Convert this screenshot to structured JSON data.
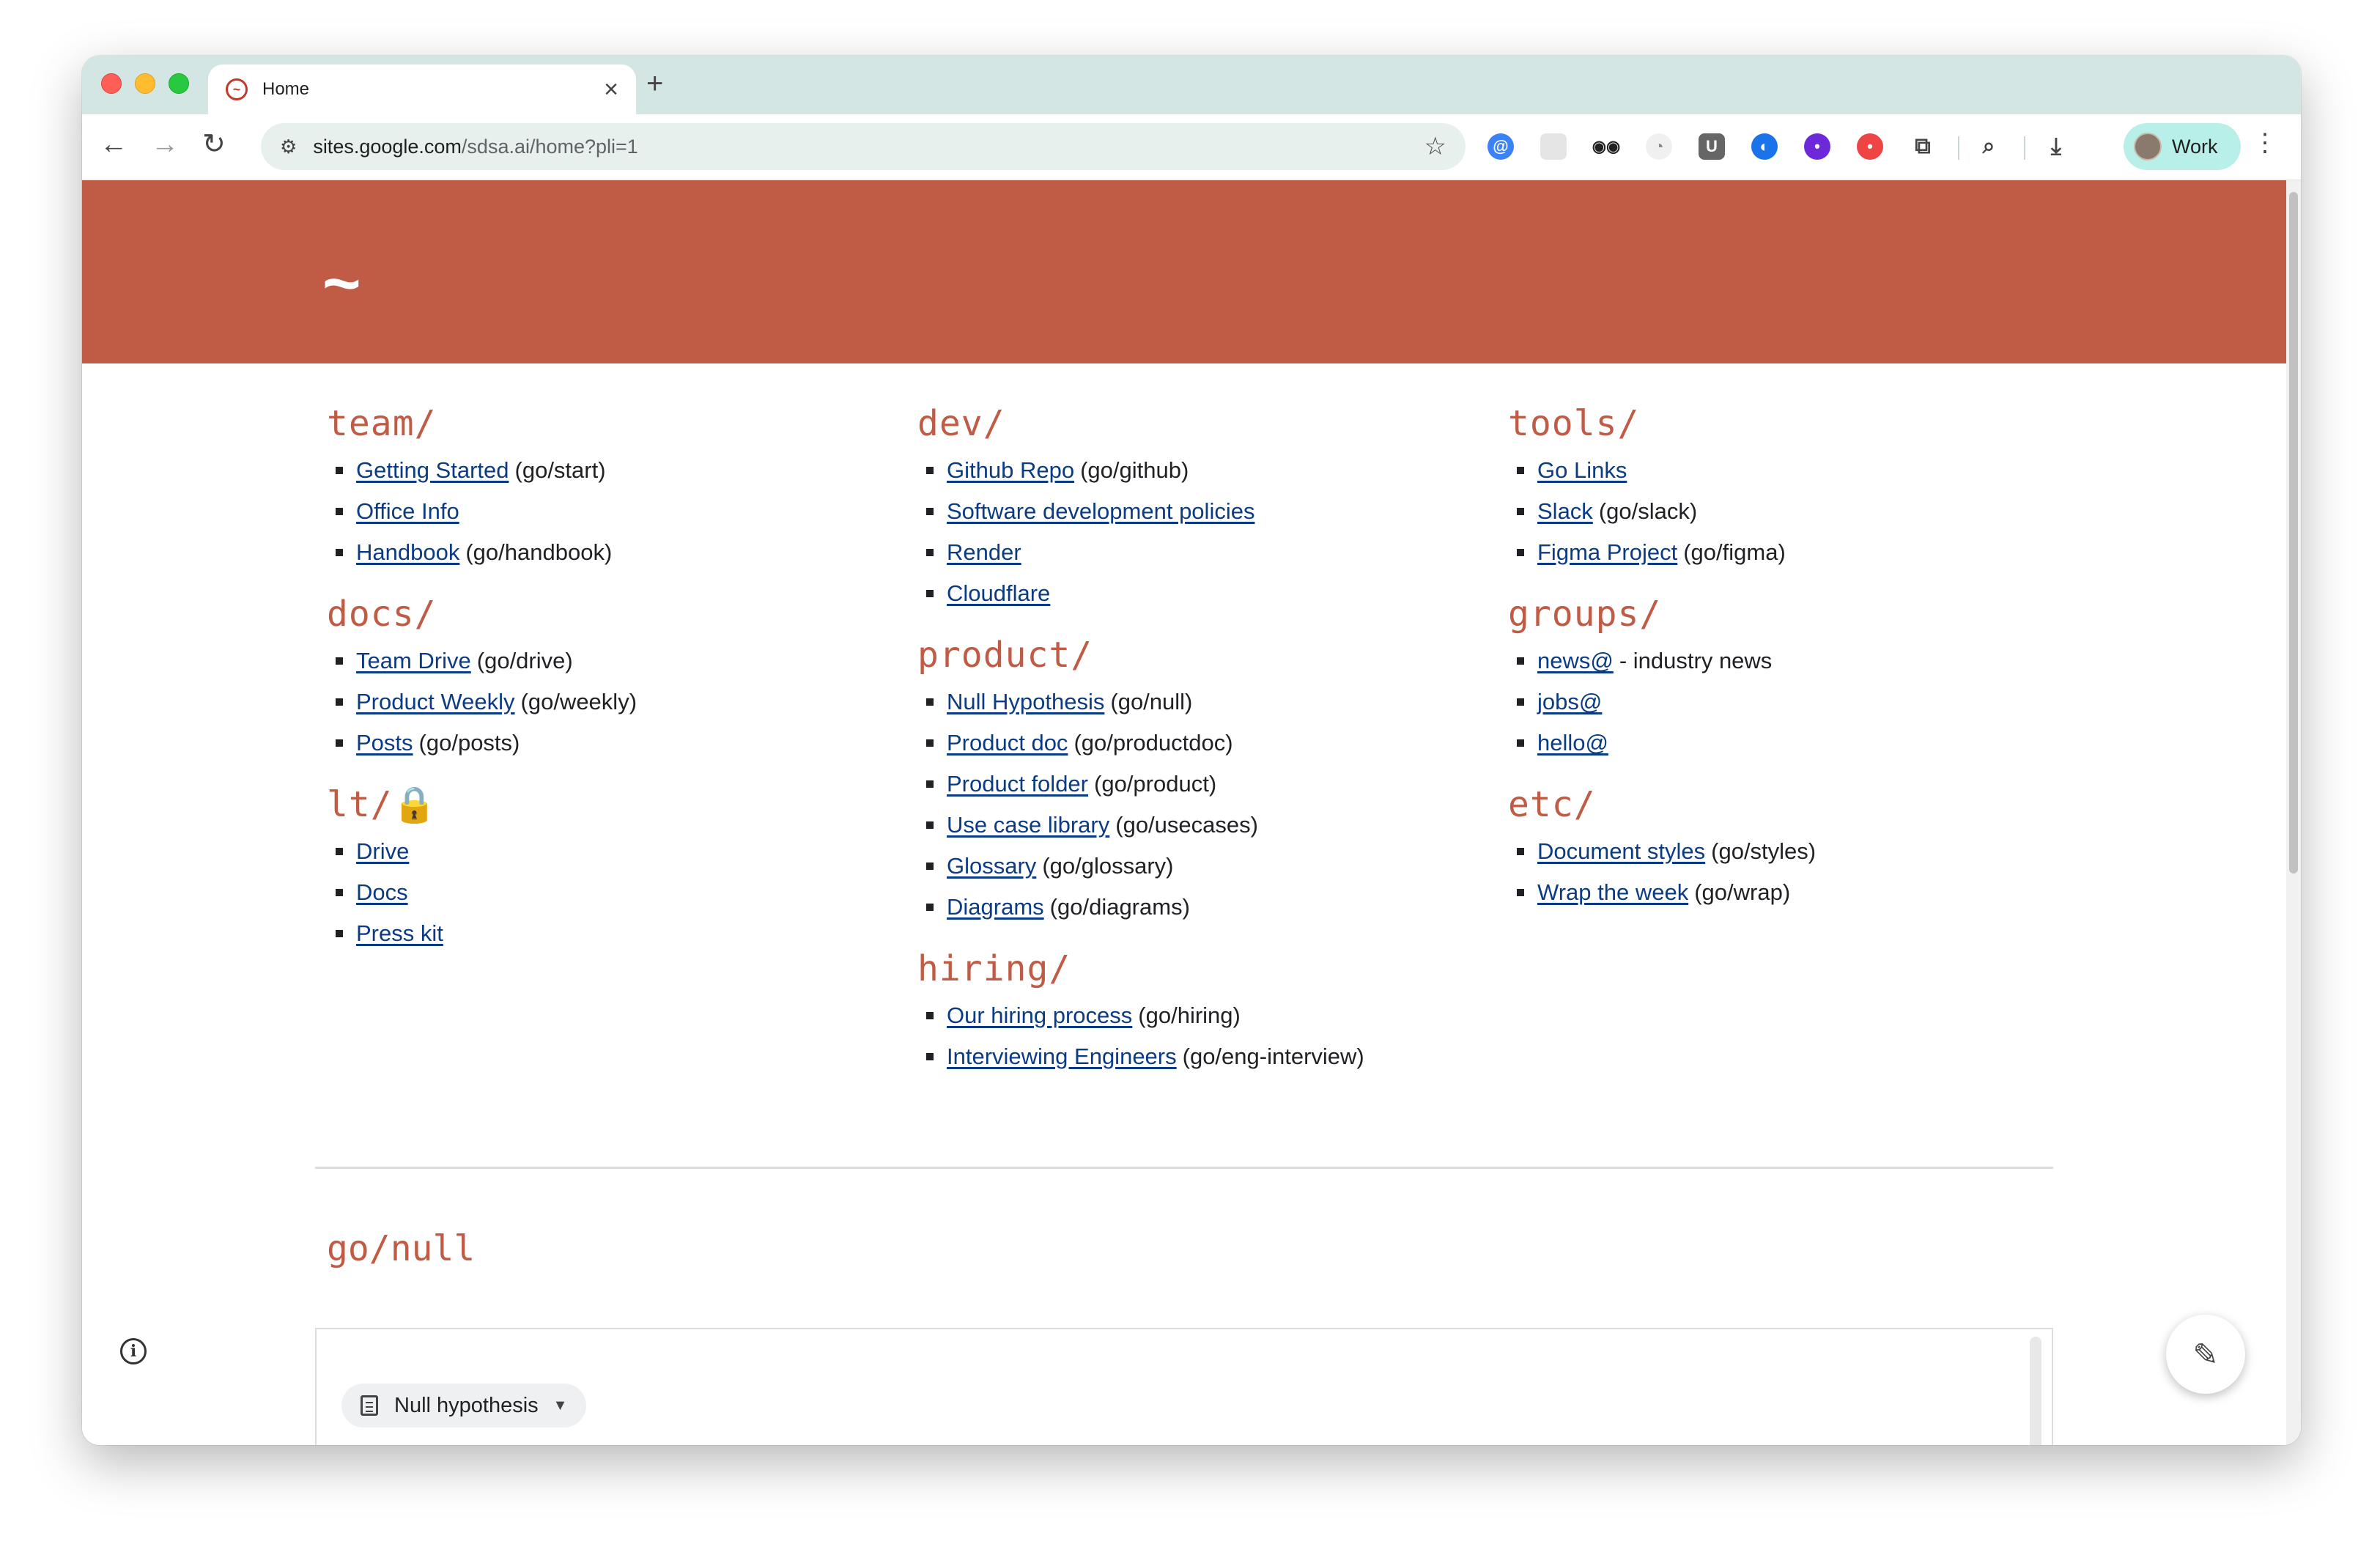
{
  "browser": {
    "tab_title": "Home",
    "close_glyph": "×",
    "newtab_glyph": "+",
    "url_host": "sites.google.com",
    "url_path": "/sdsa.ai/home?pli=1",
    "profile_label": "Work",
    "icons": {
      "back": "arrow-left-icon",
      "forward": "arrow-right-icon",
      "reload": "reload-icon",
      "star": "star-icon",
      "menu": "three-dots-icon",
      "download": "download-icon",
      "extensions": "puzzle-icon"
    }
  },
  "banner": {
    "logo": "~",
    "color": "#c05b45"
  },
  "columns": [
    {
      "sections": [
        {
          "title": "team/",
          "items": [
            {
              "link": "Getting Started",
              "note": "(go/start)"
            },
            {
              "link": "Office Info",
              "note": ""
            },
            {
              "link": "Handbook",
              "note": "(go/handbook)"
            }
          ]
        },
        {
          "title": "docs/",
          "items": [
            {
              "link": "Team Drive",
              "note": "(go/drive)"
            },
            {
              "link": "Product Weekly",
              "note": "(go/weekly)"
            },
            {
              "link": "Posts",
              "note": "(go/posts)"
            }
          ]
        },
        {
          "title": "lt/🔒",
          "items": [
            {
              "link": "Drive",
              "note": ""
            },
            {
              "link": "Docs",
              "note": ""
            },
            {
              "link": "Press kit",
              "note": ""
            }
          ]
        }
      ]
    },
    {
      "sections": [
        {
          "title": "dev/",
          "items": [
            {
              "link": "Github Repo",
              "note": "(go/github)"
            },
            {
              "link": "Software development policies",
              "note": ""
            },
            {
              "link": "Render",
              "note": ""
            },
            {
              "link": "Cloudflare",
              "note": ""
            }
          ]
        },
        {
          "title": "product/",
          "items": [
            {
              "link": "Null Hypothesis",
              "note": "(go/null)"
            },
            {
              "link": "Product doc",
              "note": "(go/productdoc)"
            },
            {
              "link": "Product folder",
              "note": "(go/product)"
            },
            {
              "link": "Use case library",
              "note": "(go/usecases)"
            },
            {
              "link": "Glossary",
              "note": "(go/glossary)"
            },
            {
              "link": "Diagrams",
              "note": "(go/diagrams)"
            }
          ]
        },
        {
          "title": "hiring/",
          "items": [
            {
              "link": "Our hiring process",
              "note": "(go/hiring)"
            },
            {
              "link": "Interviewing Engineers",
              "note": "(go/eng-interview)"
            }
          ]
        }
      ]
    },
    {
      "sections": [
        {
          "title": "tools/",
          "items": [
            {
              "link": "Go Links",
              "note": ""
            },
            {
              "link": "Slack",
              "note": "(go/slack)"
            },
            {
              "link": "Figma Project",
              "note": "(go/figma)"
            }
          ]
        },
        {
          "title": "groups/",
          "items": [
            {
              "link": "news@",
              "note": "- industry news"
            },
            {
              "link": "jobs@",
              "note": ""
            },
            {
              "link": "hello@",
              "note": ""
            }
          ]
        },
        {
          "title": "etc/",
          "items": [
            {
              "link": "Document styles",
              "note": "(go/styles)"
            },
            {
              "link": "Wrap the week",
              "note": "(go/wrap)"
            }
          ]
        }
      ]
    }
  ],
  "go_null": {
    "heading": "go/null",
    "doc_chip": "Null hypothesis"
  },
  "colors": {
    "accent": "#c05b45",
    "link": "#0b3b82"
  }
}
